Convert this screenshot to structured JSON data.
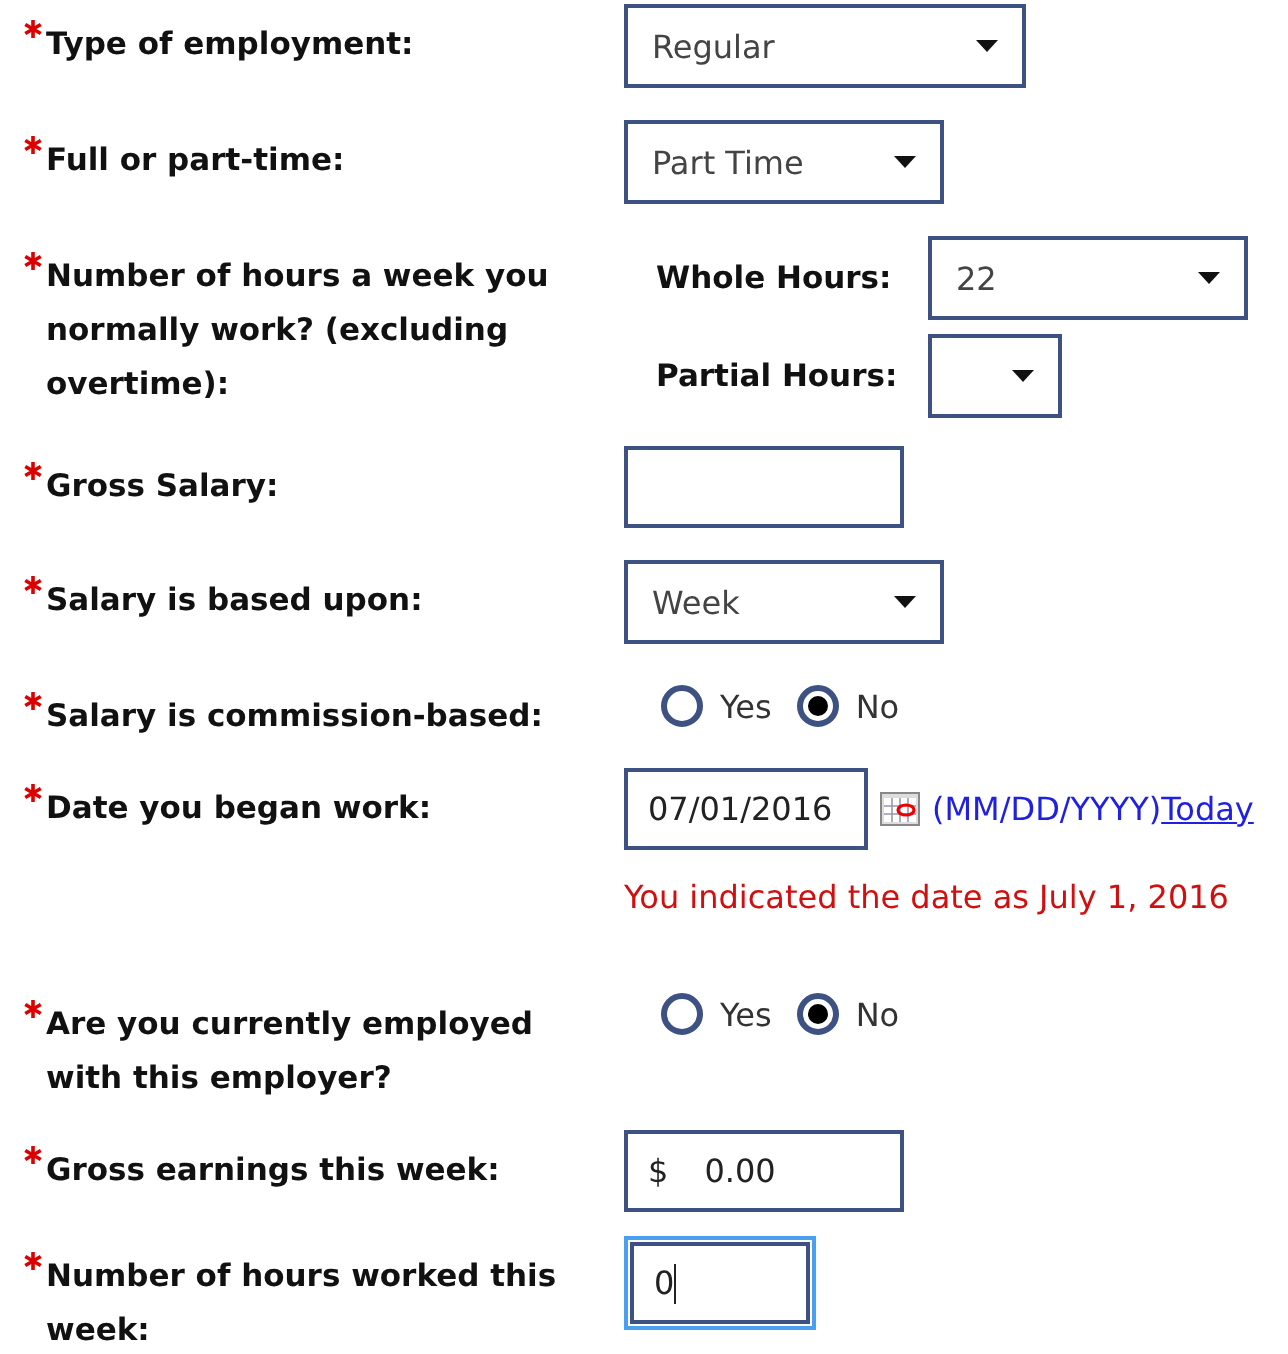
{
  "fields": [
    {
      "kind": "select",
      "label": "Type of employment:",
      "required": true,
      "value": "Regular"
    },
    {
      "kind": "select",
      "label": "Full or part-time:",
      "required": true,
      "value": "Part Time"
    },
    {
      "kind": "hours",
      "label": "Number of hours a week you normally work? (excluding overtime):",
      "required": true,
      "whole": {
        "label": "Whole Hours:",
        "value": "22"
      },
      "partial": {
        "label": "Partial Hours:"
      }
    },
    {
      "kind": "text",
      "label": "Gross Salary:",
      "required": true
    },
    {
      "kind": "select",
      "label": "Salary is based upon:",
      "required": true,
      "value": "Week"
    },
    {
      "kind": "radio",
      "label": "Salary is commission-based:",
      "required": true,
      "options": [
        {
          "label": "Yes",
          "selected": false
        },
        {
          "label": "No",
          "selected": true
        }
      ]
    },
    {
      "kind": "date",
      "label": "Date you began work:",
      "required": true,
      "value": "07/01/2016",
      "hint": "(MM/DD/YYYY)",
      "link": "Today",
      "message": "You indicated the date as July 1, 2016"
    },
    {
      "kind": "radio",
      "label": "Are you currently employed with this employer?",
      "required": true,
      "options": [
        {
          "label": "Yes",
          "selected": false
        },
        {
          "label": "No",
          "selected": true
        }
      ]
    },
    {
      "kind": "money",
      "label": "Gross earnings this week:",
      "required": true,
      "currency": "$",
      "value": "0.00"
    },
    {
      "kind": "number",
      "label": "Number of hours worked this week:",
      "required": true,
      "value": "0",
      "focused": true
    }
  ]
}
